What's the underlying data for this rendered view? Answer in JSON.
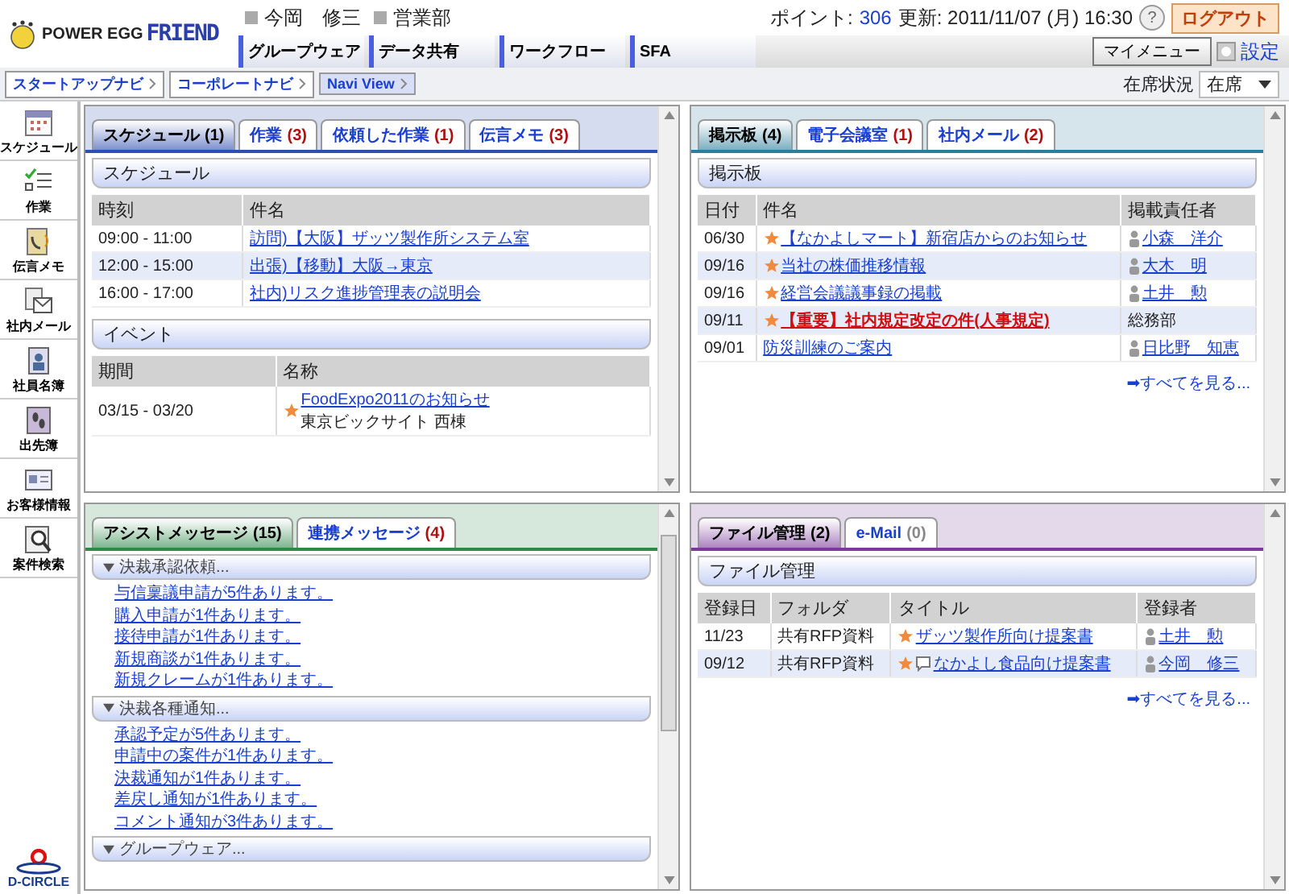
{
  "header": {
    "logo_text": "POWER EGG",
    "brand": "FRIEND",
    "user_name": "今岡　修三",
    "department": "営業部",
    "points_label": "ポイント:",
    "points": "306",
    "updated": "更新: 2011/11/07 (月) 16:30",
    "help": "?",
    "logout": "ログアウト"
  },
  "menu_tabs": [
    "グループウェア",
    "データ共有",
    "ワークフロー",
    "SFA"
  ],
  "my_menu": "マイメニュー",
  "settings": "設定",
  "nav_buttons": [
    {
      "label": "スタートアップナビ",
      "selected": false
    },
    {
      "label": "コーポレートナビ",
      "selected": false
    },
    {
      "label": "Navi View",
      "selected": true
    }
  ],
  "presence": {
    "label": "在席状況",
    "value": "在席"
  },
  "sidebar": {
    "items": [
      "スケジュール",
      "作業",
      "伝言メモ",
      "社内メール",
      "社員名簿",
      "出先簿",
      "お客様情報",
      "案件検索"
    ],
    "footer_logo": "D-CIRCLE"
  },
  "panels": [
    {
      "kind": "tables",
      "color": "#2f4fb0",
      "tabs": [
        {
          "label": "スケジュール",
          "count": "(1)",
          "selected": true,
          "alert": false
        },
        {
          "label": "作業",
          "count": "(3)",
          "selected": false,
          "alert": true
        },
        {
          "label": "依頼した作業",
          "count": "(1)",
          "selected": false,
          "alert": true
        },
        {
          "label": "伝言メモ",
          "count": "(3)",
          "selected": false,
          "alert": true
        }
      ],
      "sections": [
        {
          "title": "スケジュール",
          "columns": [
            "時刻",
            "件名"
          ],
          "rows": [
            [
              {
                "text": "09:00 - 11:00"
              },
              {
                "text": "訪問)【大阪】ザッツ製作所システム室",
                "link": true
              }
            ],
            [
              {
                "text": "12:00 - 15:00"
              },
              {
                "text": "出張)【移動】大阪→東京",
                "link": true
              }
            ],
            [
              {
                "text": "16:00 - 17:00"
              },
              {
                "text": "社内)リスク進捗管理表の説明会",
                "link": true
              }
            ]
          ]
        },
        {
          "title": "イベント",
          "columns": [
            "期間",
            "名称"
          ],
          "rows": [
            [
              {
                "text": "03/15 - 03/20"
              },
              {
                "text": "FoodExpo2011のお知らせ",
                "link": true,
                "star": true,
                "sub": "東京ビックサイト 西棟"
              }
            ]
          ]
        }
      ]
    },
    {
      "kind": "tables",
      "color": "#2b7f9a",
      "tabs": [
        {
          "label": "掲示板",
          "count": "(4)",
          "selected": true,
          "alert": false
        },
        {
          "label": "電子会議室",
          "count": "(1)",
          "selected": false,
          "alert": true
        },
        {
          "label": "社内メール",
          "count": "(2)",
          "selected": false,
          "alert": true
        }
      ],
      "sections": [
        {
          "title": "掲示板",
          "columns": [
            "日付",
            "件名",
            "掲載責任者"
          ],
          "rows": [
            [
              {
                "text": "06/30"
              },
              {
                "text": "【なかよしマート】新宿店からのお知らせ",
                "link": true,
                "star": true
              },
              {
                "text": "小森　洋介",
                "link": true,
                "person": true
              }
            ],
            [
              {
                "text": "09/16"
              },
              {
                "text": "当社の株価推移情報",
                "link": true,
                "star": true
              },
              {
                "text": "大木　明",
                "link": true,
                "person": true
              }
            ],
            [
              {
                "text": "09/16"
              },
              {
                "text": "経営会議議事録の掲載",
                "link": true,
                "star": true
              },
              {
                "text": "土井　勲",
                "link": true,
                "person": true
              }
            ],
            [
              {
                "text": "09/11"
              },
              {
                "text": "【重要】社内規定改定の件(人事規定)",
                "link": true,
                "star": true,
                "urgent": true
              },
              {
                "text": "総務部"
              }
            ],
            [
              {
                "text": "09/01"
              },
              {
                "text": "防災訓練のご案内",
                "link": true
              },
              {
                "text": "日比野　知恵",
                "link": true,
                "person": true
              }
            ]
          ]
        }
      ],
      "see_all": "➡すべてを見る..."
    },
    {
      "kind": "messages",
      "color": "#2f8a4a",
      "tabs": [
        {
          "label": "アシストメッセージ",
          "count": "(15)",
          "selected": true,
          "alert": false
        },
        {
          "label": "連携メッセージ",
          "count": "(4)",
          "selected": false,
          "alert": true
        }
      ],
      "groups": [
        {
          "title": "決裁承認依頼...",
          "expanded": true,
          "items": [
            "与信稟議申請が5件あります。",
            "購入申請が1件あります。",
            "接待申請が1件あります。",
            "新規商談が1件あります。",
            "新規クレームが1件あります。"
          ]
        },
        {
          "title": "決裁各種通知...",
          "expanded": true,
          "items": [
            "承認予定が5件あります。",
            "申請中の案件が1件あります。",
            "決裁通知が1件あります。",
            "差戻し通知が1件あります。",
            "コメント通知が3件あります。"
          ]
        },
        {
          "title": "グループウェア...",
          "expanded": true
        }
      ]
    },
    {
      "kind": "tables",
      "color": "#7a3a9a",
      "tabs": [
        {
          "label": "ファイル管理",
          "count": "(2)",
          "selected": true,
          "alert": false
        },
        {
          "label": "e-Mail",
          "count": "(0)",
          "selected": false,
          "alert": false
        }
      ],
      "sections": [
        {
          "title": "ファイル管理",
          "columns": [
            "登録日",
            "フォルダ",
            "タイトル",
            "登録者"
          ],
          "rows": [
            [
              {
                "text": "11/23"
              },
              {
                "text": "共有RFP資料"
              },
              {
                "text": "ザッツ製作所向け提案書",
                "link": true,
                "star": true
              },
              {
                "text": "土井　勲",
                "link": true,
                "person": true
              }
            ],
            [
              {
                "text": "09/12"
              },
              {
                "text": "共有RFP資料"
              },
              {
                "text": "なかよし食品向け提案書",
                "link": true,
                "star": true,
                "comment": true
              },
              {
                "text": "今岡　修三",
                "link": true,
                "person": true
              }
            ]
          ]
        }
      ],
      "see_all": "➡すべてを見る..."
    }
  ]
}
